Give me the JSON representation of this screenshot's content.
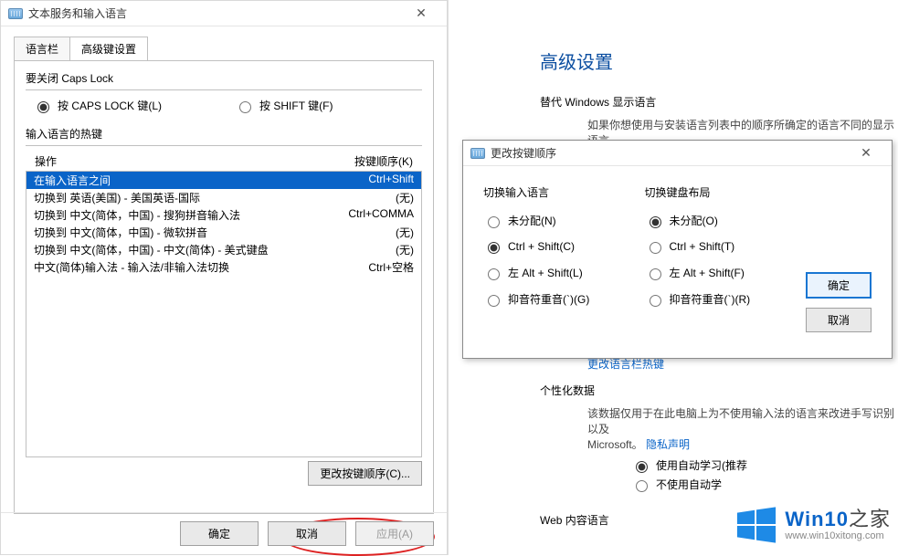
{
  "dialog1": {
    "title": "文本服务和输入语言",
    "tabs": {
      "langbar": "语言栏",
      "advanced": "高级键设置"
    },
    "capslock": {
      "group_label": "要关闭 Caps Lock",
      "opt_capslock": "按 CAPS LOCK 键(L)",
      "opt_shift": "按 SHIFT 键(F)"
    },
    "hotkeys": {
      "group_label": "输入语言的热键",
      "col_action": "操作",
      "col_seq": "按键顺序(K)",
      "rows": [
        {
          "action": "在输入语言之间",
          "seq": "Ctrl+Shift"
        },
        {
          "action": "切换到 英语(美国) - 美国英语-国际",
          "seq": "(无)"
        },
        {
          "action": "切换到 中文(简体，中国) - 搜狗拼音输入法",
          "seq": "Ctrl+COMMA"
        },
        {
          "action": "切换到 中文(简体，中国) - 微软拼音",
          "seq": "(无)"
        },
        {
          "action": "切换到 中文(简体，中国) - 中文(简体) - 美式键盘",
          "seq": "(无)"
        },
        {
          "action": "中文(简体)输入法 - 输入法/非输入法切换",
          "seq": "Ctrl+空格"
        }
      ],
      "change_btn": "更改按键顺序(C)..."
    },
    "buttons": {
      "ok": "确定",
      "cancel": "取消",
      "apply": "应用(A)"
    }
  },
  "dialog2": {
    "title": "更改按键顺序",
    "left": {
      "title": "切换输入语言",
      "opts": {
        "none": "未分配(N)",
        "ctrlshift": "Ctrl + Shift(C)",
        "altshift": "左 Alt + Shift(L)",
        "grave": "抑音符重音(`)(G)"
      }
    },
    "right": {
      "title": "切换键盘布局",
      "opts": {
        "none": "未分配(O)",
        "ctrlshift": "Ctrl + Shift(T)",
        "altshift": "左 Alt + Shift(F)",
        "grave": "抑音符重音(`)(R)"
      }
    },
    "buttons": {
      "ok": "确定",
      "cancel": "取消"
    }
  },
  "settings": {
    "heading": "高级设置",
    "s1_title": "替代 Windows 显示语言",
    "s1_text": "如果你想使用与安装语言列表中的顺序所确定的语言不同的显示语言",
    "s3_link": "更改语言栏热键",
    "s4_title": "个性化数据",
    "s4_text_a": "该数据仅用于在此电脑上为不使用输入法的语言来改进手写识别以及",
    "s4_text_b": "Microsoft。",
    "s4_privacy": "隐私声明",
    "s4_opt_on": "使用自动学习(推荐",
    "s4_opt_off": "不使用自动学",
    "s5_title": "Web 内容语言"
  },
  "watermark": {
    "brand_a": "Win10",
    "brand_b": "之家",
    "url": "www.win10xitong.com"
  }
}
